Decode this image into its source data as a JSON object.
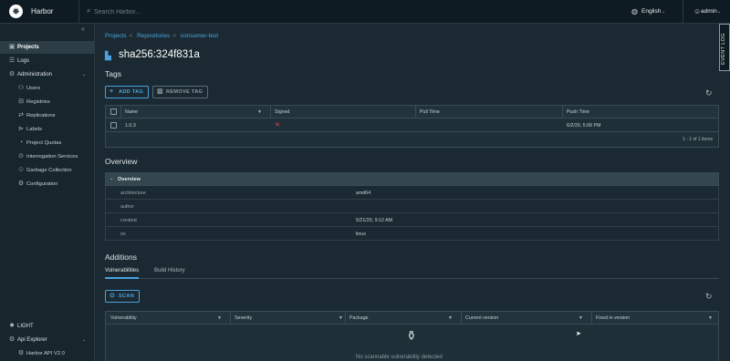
{
  "header": {
    "brand": "Harbor",
    "search_placeholder": "Search Harbor...",
    "language": "English",
    "user": "admin"
  },
  "sidebar": {
    "items": [
      {
        "label": "Projects",
        "icon": "projects-icon"
      },
      {
        "label": "Logs",
        "icon": "logs-icon"
      },
      {
        "label": "Administration",
        "icon": "admin-icon"
      },
      {
        "label": "Users",
        "icon": "users-icon"
      },
      {
        "label": "Registries",
        "icon": "registries-icon"
      },
      {
        "label": "Replications",
        "icon": "replications-icon"
      },
      {
        "label": "Labels",
        "icon": "labels-icon"
      },
      {
        "label": "Project Quotas",
        "icon": "quotas-icon"
      },
      {
        "label": "Interrogation Services",
        "icon": "interrogation-icon"
      },
      {
        "label": "Garbage Collection",
        "icon": "gc-icon"
      },
      {
        "label": "Configuration",
        "icon": "config-icon"
      }
    ],
    "theme": "LIGHT",
    "api_explorer": "Api Explorer",
    "api_v2": "Harbor API V2.0"
  },
  "breadcrumb": {
    "projects": "Projects",
    "repositories": "Repositories",
    "repo": "consumer-test",
    "sep": "<"
  },
  "artifact": {
    "title": "sha256:324f831a"
  },
  "tags": {
    "heading": "Tags",
    "add_label": "ADD TAG",
    "remove_label": "REMOVE TAG",
    "columns": [
      "Name",
      "Signed",
      "Pull Time",
      "Push Time"
    ],
    "rows": [
      {
        "name": "1.0.3",
        "signed": "✕",
        "pull_time": "",
        "push_time": "6/2/20, 5:09 PM"
      }
    ],
    "footer": "1 - 1 of 1 items"
  },
  "overview": {
    "heading": "Overview",
    "section": "Overview",
    "rows": [
      {
        "key": "architecture",
        "value": "amd64"
      },
      {
        "key": "author",
        "value": ""
      },
      {
        "key": "created",
        "value": "5/21/20, 9:12 AM"
      },
      {
        "key": "os",
        "value": "linux"
      }
    ]
  },
  "additions": {
    "heading": "Additions",
    "tabs": [
      "Vulnerabilities",
      "Build History"
    ],
    "scan_label": "SCAN",
    "columns": [
      "Vulnerability",
      "Severity",
      "Package",
      "Current version",
      "Fixed in version"
    ],
    "empty_text": "No scannable vulnerability detected"
  },
  "event_log": "EVENT LOG",
  "colors": {
    "accent": "#4aa3df",
    "background": "#1b2a32",
    "header": "#0e1b22",
    "danger": "#e24b4b"
  }
}
